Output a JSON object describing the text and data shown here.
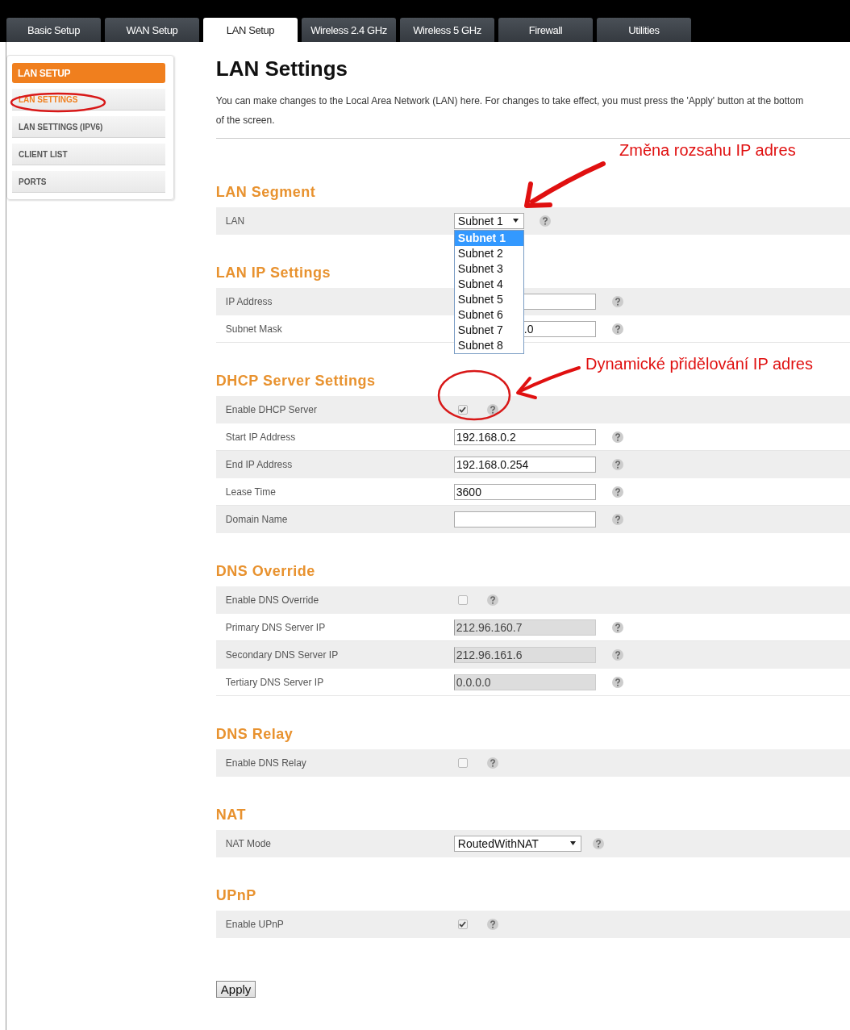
{
  "tabs": [
    {
      "label": "Basic Setup",
      "selected": false
    },
    {
      "label": "WAN Setup",
      "selected": false
    },
    {
      "label": "LAN Setup",
      "selected": true
    },
    {
      "label": "Wireless 2.4 GHz",
      "selected": false
    },
    {
      "label": "Wireless 5 GHz",
      "selected": false
    },
    {
      "label": "Firewall",
      "selected": false
    },
    {
      "label": "Utilities",
      "selected": false
    }
  ],
  "sidebar": {
    "title": "LAN SETUP",
    "items": [
      {
        "label": "LAN SETTINGS",
        "selected": true
      },
      {
        "label": "LAN SETTINGS (IPV6)",
        "selected": false
      },
      {
        "label": "CLIENT LIST",
        "selected": false
      },
      {
        "label": "PORTS",
        "selected": false
      }
    ]
  },
  "page": {
    "title": "LAN Settings",
    "description": "You can make changes to the Local Area Network (LAN) here. For changes to take effect, you must press the 'Apply' button at the bottom of the screen."
  },
  "sections": [
    {
      "heading": "LAN Segment",
      "rows": [
        {
          "kind": "select",
          "label": "LAN",
          "value": "Subnet 1",
          "expanded": true,
          "options": [
            {
              "label": "Subnet 1",
              "selected": true
            },
            {
              "label": "Subnet 2",
              "selected": false
            },
            {
              "label": "Subnet 3",
              "selected": false
            },
            {
              "label": "Subnet 4",
              "selected": false
            },
            {
              "label": "Subnet 5",
              "selected": false
            },
            {
              "label": "Subnet 6",
              "selected": false
            },
            {
              "label": "Subnet 7",
              "selected": false
            },
            {
              "label": "Subnet 8",
              "selected": false
            }
          ]
        }
      ]
    },
    {
      "heading": "LAN IP Settings",
      "rows": [
        {
          "kind": "input",
          "label": "IP Address",
          "disabled": false
        },
        {
          "kind": "input",
          "label": "Subnet Mask",
          "value": ".0",
          "covered": true,
          "disabled": false
        }
      ]
    },
    {
      "heading": "DHCP Server Settings",
      "rows": [
        {
          "kind": "checkbox",
          "label": "Enable DHCP Server",
          "checked": true
        },
        {
          "kind": "input",
          "label": "Start IP Address",
          "value": "192.168.0.2",
          "covered": false,
          "disabled": false
        },
        {
          "kind": "input",
          "label": "End IP Address",
          "value": "192.168.0.254",
          "covered": false,
          "disabled": false
        },
        {
          "kind": "input",
          "label": "Lease Time",
          "value": "3600",
          "covered": false,
          "disabled": false
        },
        {
          "kind": "input",
          "label": "Domain Name",
          "disabled": false
        }
      ]
    },
    {
      "heading": "DNS Override",
      "rows": [
        {
          "kind": "checkbox",
          "label": "Enable DNS Override",
          "checked": false
        },
        {
          "kind": "input",
          "label": "Primary DNS Server IP",
          "value": "212.96.160.7",
          "covered": false,
          "disabled": true
        },
        {
          "kind": "input",
          "label": "Secondary DNS Server IP",
          "value": "212.96.161.6",
          "covered": false,
          "disabled": true
        },
        {
          "kind": "input",
          "label": "Tertiary DNS Server IP",
          "value": "0.0.0.0",
          "covered": false,
          "disabled": true
        }
      ]
    },
    {
      "heading": "DNS Relay",
      "rows": [
        {
          "kind": "checkbox",
          "label": "Enable DNS Relay",
          "checked": false
        }
      ]
    },
    {
      "heading": "NAT",
      "rows": [
        {
          "kind": "select",
          "label": "NAT Mode",
          "value": "RoutedWithNAT",
          "expanded": false
        }
      ]
    },
    {
      "heading": "UPnP",
      "rows": [
        {
          "kind": "checkbox",
          "label": "Enable UPnP",
          "checked": true
        }
      ]
    }
  ],
  "apply_button": "Apply",
  "annotations": [
    {
      "text": "Změna rozsahu IP adres"
    },
    {
      "text": "Dynamické přidělování IP adres"
    }
  ]
}
